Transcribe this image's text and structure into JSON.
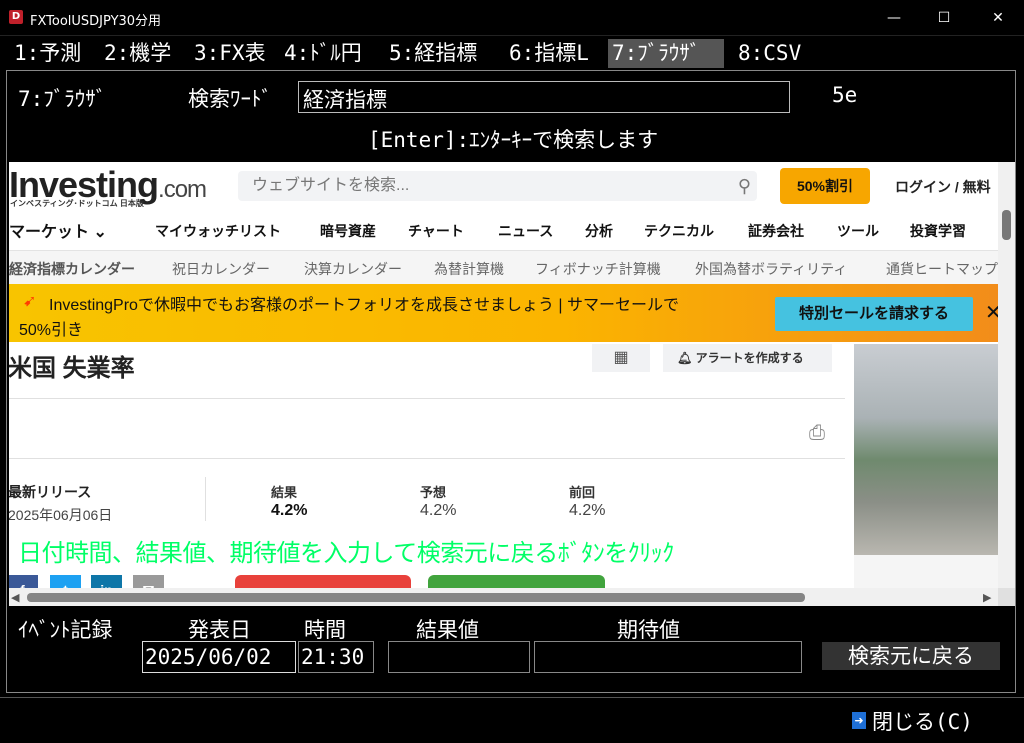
{
  "window": {
    "app_icon": "D",
    "title": "FXToolUSDJPY30分用",
    "min": "—",
    "max": "☐",
    "close": "✕"
  },
  "tabs": [
    {
      "label": "1:予測"
    },
    {
      "label": "2:機学"
    },
    {
      "label": "3:FX表"
    },
    {
      "label": "4:ﾄﾞﾙ円"
    },
    {
      "label": "5:経指標"
    },
    {
      "label": "6:指標L"
    },
    {
      "label": "7:ﾌﾞﾗｳｻﾞ",
      "active": true
    },
    {
      "label": "8:CSV"
    }
  ],
  "browser_panel": {
    "section_label": "7:ﾌﾞﾗｳｻﾞ",
    "search_label": "検索ﾜｰﾄﾞ",
    "search_value": "経済指標",
    "code": "5e",
    "hint": "[Enter]:ｴﾝﾀｰｷｰで検索します"
  },
  "site": {
    "logo_main": "Investing",
    "logo_suffix": ".com",
    "logo_sub": "インベスティング･ドットコム 日本版",
    "search_placeholder": "ウェブサイトを検索...",
    "promo_button": "50%割引",
    "login": "ログイン / 無料",
    "nav": [
      "マーケット ⌄",
      "マイウォッチリスト",
      "暗号資産",
      "チャート",
      "ニュース",
      "分析",
      "テクニカル",
      "証券会社",
      "ツール",
      "投資学習"
    ],
    "subnav": [
      "経済指標カレンダー",
      "祝日カレンダー",
      "決算カレンダー",
      "為替計算機",
      "フィボナッチ計算機",
      "外国為替ボラティリティ",
      "通貨ヒートマップ"
    ],
    "banner_text_1": "InvestingProで休暇中でもお客様のポートフォリオを成長させましょう | サマーセールで",
    "banner_text_2": "50%引き",
    "banner_button": "特別セールを請求する",
    "banner_close": "✕",
    "page_title": "米国 失業率",
    "alert_button": "アラートを作成する",
    "latest_release_label": "最新リリース",
    "latest_release_date": "2025年06月06日",
    "result_label": "結果",
    "result_value": "4.2%",
    "forecast_label": "予想",
    "forecast_value": "4.2%",
    "previous_label": "前回",
    "previous_value": "4.2%",
    "social": [
      "f",
      "t",
      "in",
      "✉"
    ]
  },
  "overlay_instruction": "日付時間、結果値、期待値を入力して検索元に戻るﾎﾞﾀﾝをｸﾘｯｸ",
  "event_form": {
    "record_label": "ｲﾍﾞﾝﾄ記録",
    "date_label": "発表日",
    "time_label": "時間",
    "result_label": "結果値",
    "expected_label": "期待値",
    "date_value": "2025/06/02",
    "time_value": "21:30",
    "result_value": "",
    "expected_value": "",
    "back_button": "検索元に戻る"
  },
  "footer": {
    "close_button": "閉じる(C)"
  },
  "colors": {
    "accent_orange": "#f7a600",
    "banner_button": "#45c2e0",
    "overlay_text": "#00ff66",
    "investing_red": "#e8413b",
    "investing_green": "#41a43d"
  }
}
